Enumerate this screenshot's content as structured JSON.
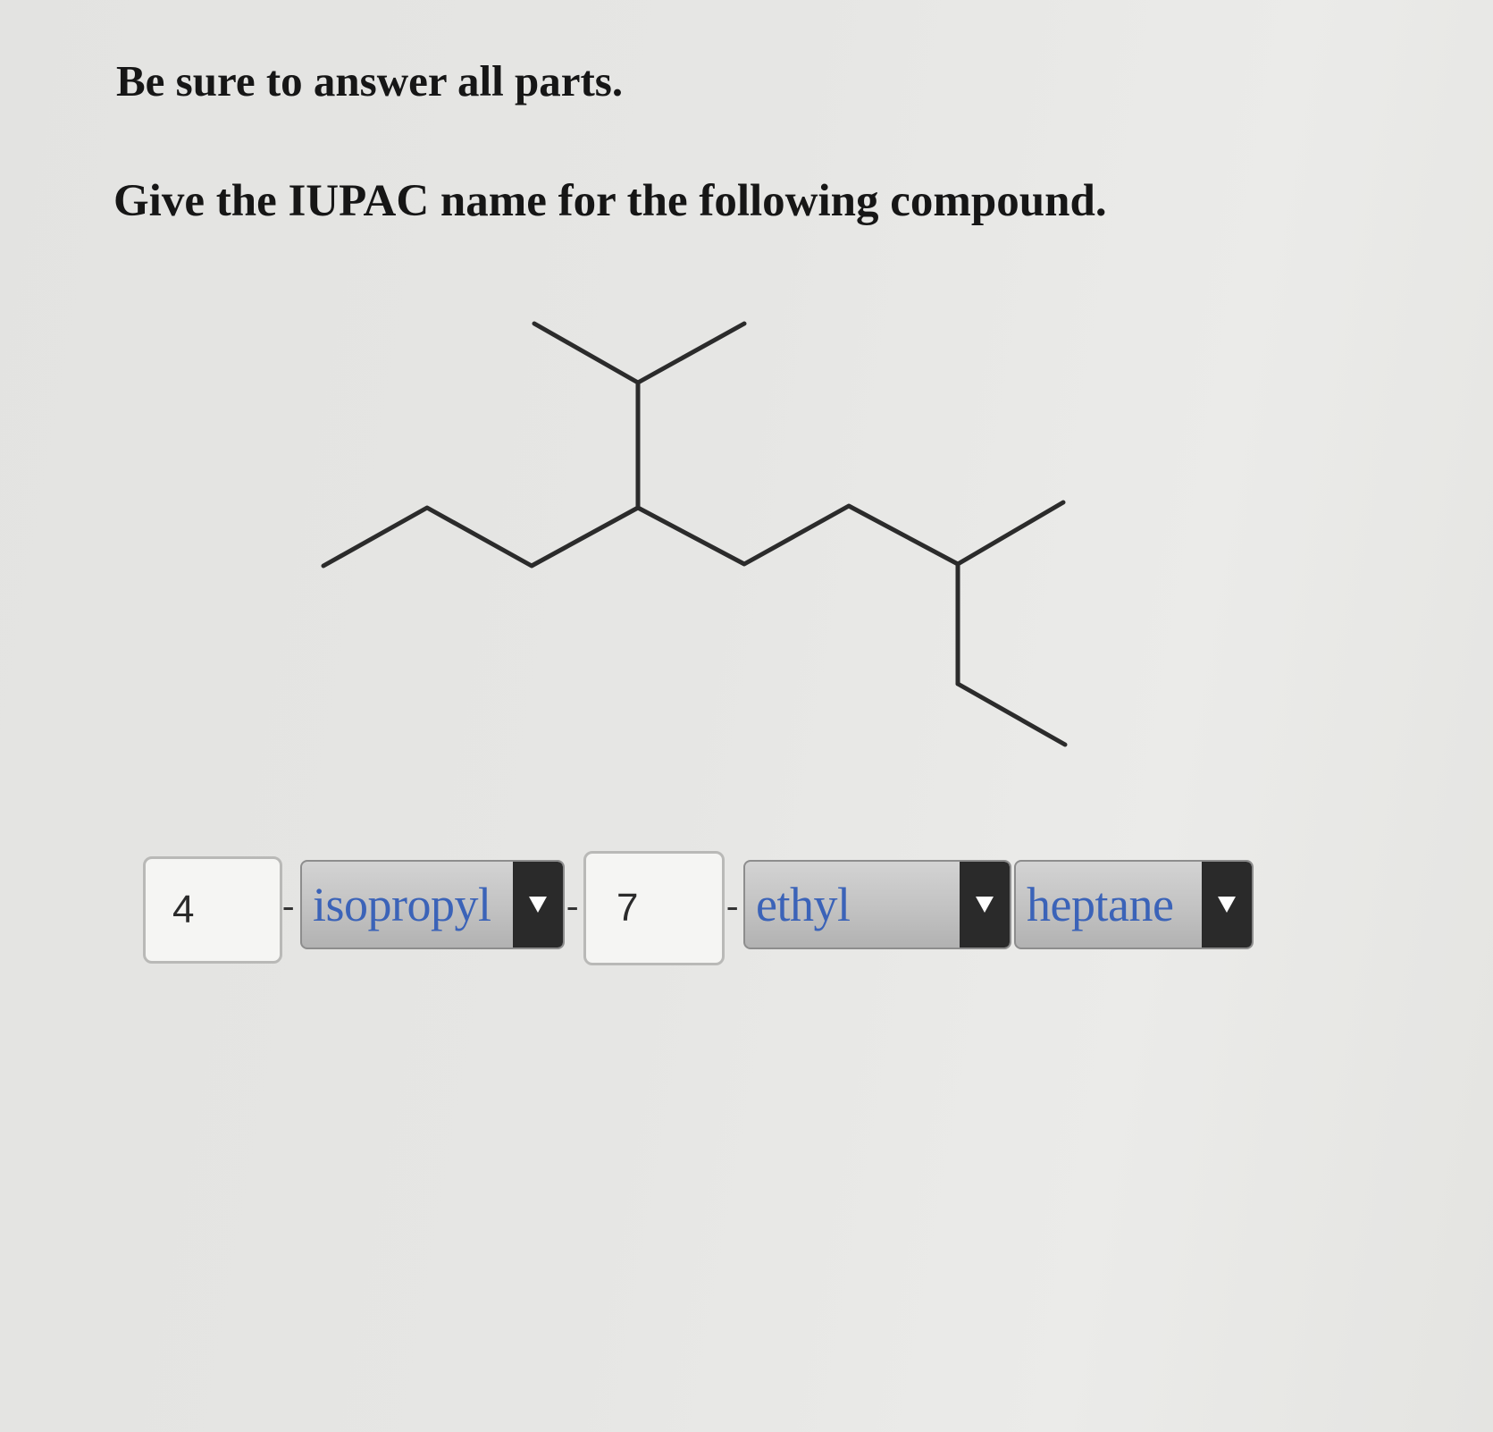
{
  "instruction": "Be sure to answer all parts.",
  "question": "Give the IUPAC name for the following compound.",
  "answer": {
    "locant_1": "4",
    "substituent_1": "isopropyl",
    "locant_2": "7",
    "substituent_2": "ethyl",
    "parent_chain": "heptane",
    "hyphen": "-"
  },
  "icons": {
    "dropdown_arrow": "chevron-down-icon"
  },
  "colors": {
    "dropdown_text": "#3b63b8",
    "dropdown_arrow_bg": "#2a2a2a",
    "structure_line": "#2b2b2b"
  }
}
